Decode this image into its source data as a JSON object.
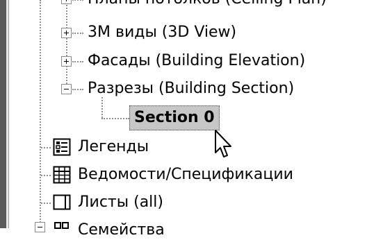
{
  "tree": {
    "items": [
      {
        "label": "Планы потолков (Ceiling Plan)",
        "expander": "plus"
      },
      {
        "label": "3М виды (3D View)",
        "expander": "plus"
      },
      {
        "label": "Фасады (Building Elevation)",
        "expander": "plus"
      },
      {
        "label": "Разрезы (Building Section)",
        "expander": "minus"
      },
      {
        "label": "Section 0",
        "selected": true
      },
      {
        "label": "Легенды",
        "icon": "legend-icon"
      },
      {
        "label": "Ведомости/Спецификации",
        "icon": "schedule-icon"
      },
      {
        "label": "Листы (all)",
        "icon": "sheet-icon"
      },
      {
        "label": "Семейства",
        "icon": "family-icon",
        "expander": "minus"
      }
    ]
  },
  "colors": {
    "selection_bg": "#c7c7c7",
    "tree_line": "#8f8f8f",
    "border_dark": "#5a5a5a"
  }
}
